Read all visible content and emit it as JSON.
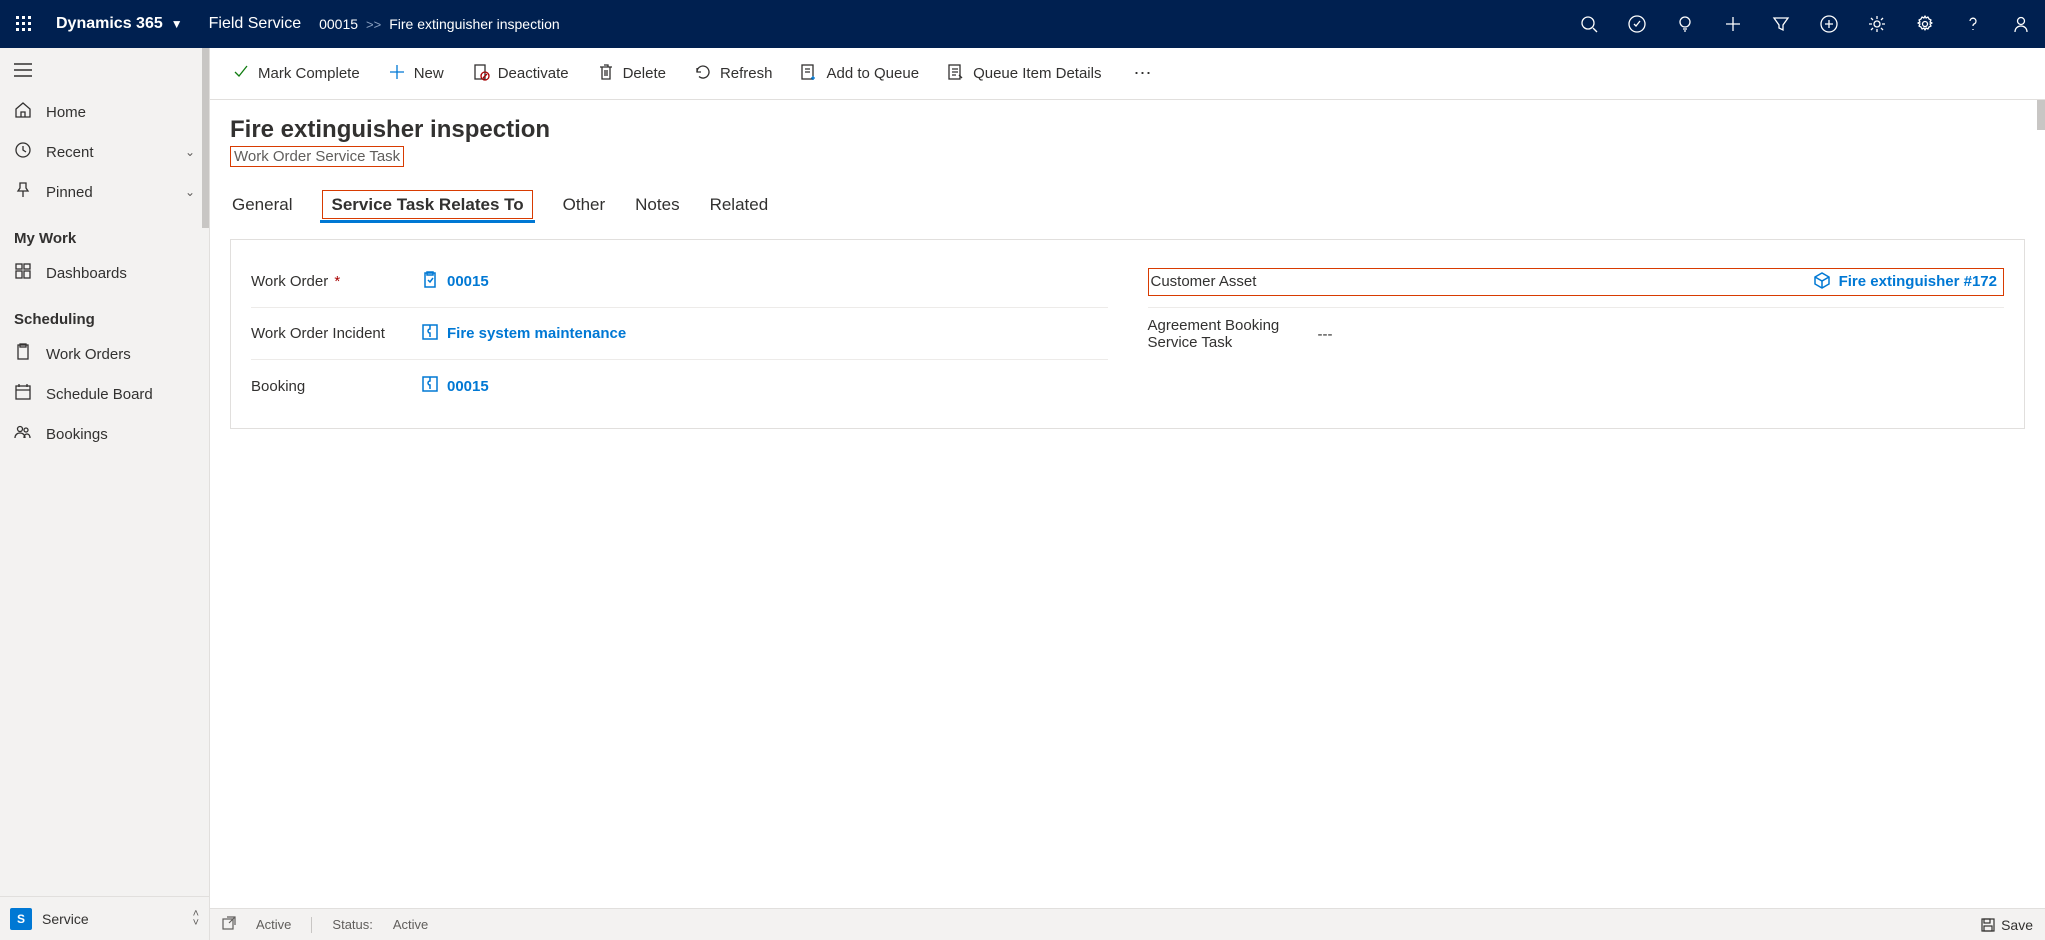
{
  "header": {
    "brand": "Dynamics 365",
    "app": "Field Service",
    "breadcrumb": [
      "00015",
      "Fire extinguisher inspection"
    ]
  },
  "sidebar": {
    "items": [
      {
        "icon": "home",
        "label": "Home"
      },
      {
        "icon": "clock",
        "label": "Recent",
        "expandable": true
      },
      {
        "icon": "pin",
        "label": "Pinned",
        "expandable": true
      }
    ],
    "sections": [
      {
        "title": "My Work",
        "items": [
          {
            "icon": "dashboard",
            "label": "Dashboards"
          }
        ]
      },
      {
        "title": "Scheduling",
        "items": [
          {
            "icon": "clipboard",
            "label": "Work Orders"
          },
          {
            "icon": "calendar",
            "label": "Schedule Board"
          },
          {
            "icon": "people",
            "label": "Bookings"
          }
        ]
      }
    ],
    "area": {
      "badge": "S",
      "label": "Service"
    }
  },
  "commands": [
    {
      "name": "mark-complete",
      "label": "Mark Complete",
      "icon": "check",
      "color": "green"
    },
    {
      "name": "new",
      "label": "New",
      "icon": "plus",
      "color": "blue"
    },
    {
      "name": "deactivate",
      "label": "Deactivate",
      "icon": "deactivate"
    },
    {
      "name": "delete",
      "label": "Delete",
      "icon": "trash"
    },
    {
      "name": "refresh",
      "label": "Refresh",
      "icon": "refresh"
    },
    {
      "name": "add-to-queue",
      "label": "Add to Queue",
      "icon": "queue"
    },
    {
      "name": "queue-item-details",
      "label": "Queue Item Details",
      "icon": "details"
    }
  ],
  "record": {
    "title": "Fire extinguisher inspection",
    "subtitle": "Work Order Service Task"
  },
  "tabs": [
    "General",
    "Service Task Relates To",
    "Other",
    "Notes",
    "Related"
  ],
  "active_tab": "Service Task Relates To",
  "form": {
    "left": [
      {
        "label": "Work Order",
        "required": true,
        "icon": "clipboard",
        "value": "00015",
        "link": true
      },
      {
        "label": "Work Order Incident",
        "icon": "puzzle",
        "value": "Fire system maintenance",
        "link": true
      },
      {
        "label": "Booking",
        "icon": "puzzle",
        "value": "00015",
        "link": true
      }
    ],
    "right": [
      {
        "label": "Customer Asset",
        "icon": "box",
        "value": "Fire extinguisher #172",
        "link": true,
        "highlight": true
      },
      {
        "label": "Agreement Booking Service Task",
        "value": "---",
        "link": false
      }
    ]
  },
  "status": {
    "state": "Active",
    "status_label": "Status:",
    "status_value": "Active",
    "save": "Save"
  }
}
